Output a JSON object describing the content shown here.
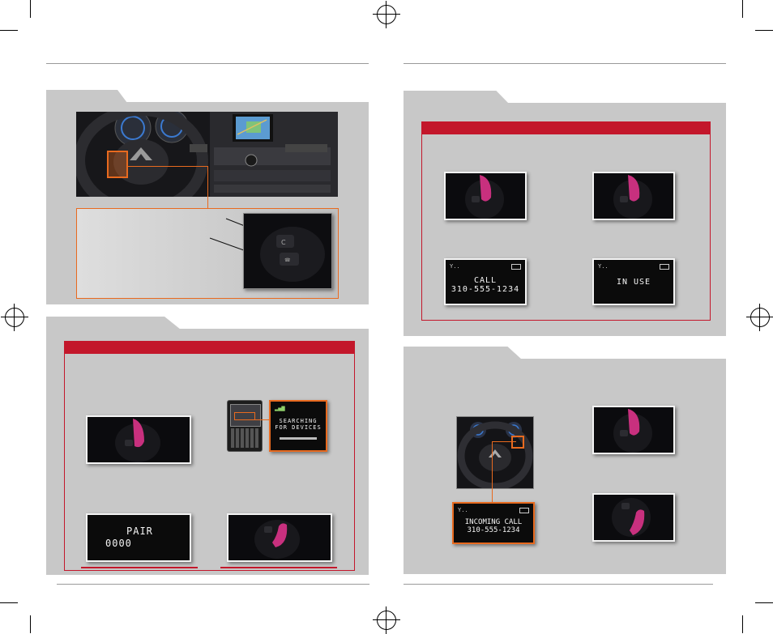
{
  "left_page": {
    "screens": {
      "searching_line1": "SEARCHING",
      "searching_line2": "FOR DEVICES",
      "pair_line1": "PAIR",
      "pair_line2": "0000"
    }
  },
  "right_page": {
    "screens": {
      "call_line1": "CALL",
      "call_line2": "310-555-1234",
      "in_use": "IN USE",
      "incoming_line1": "INCOMING CALL",
      "incoming_line2": "310-555-1234"
    }
  },
  "colors": {
    "accent_red": "#c3172b",
    "callout_orange": "#e86a1f",
    "panel_gray": "#c8c8c8",
    "button_magenta": "#c8307e"
  }
}
